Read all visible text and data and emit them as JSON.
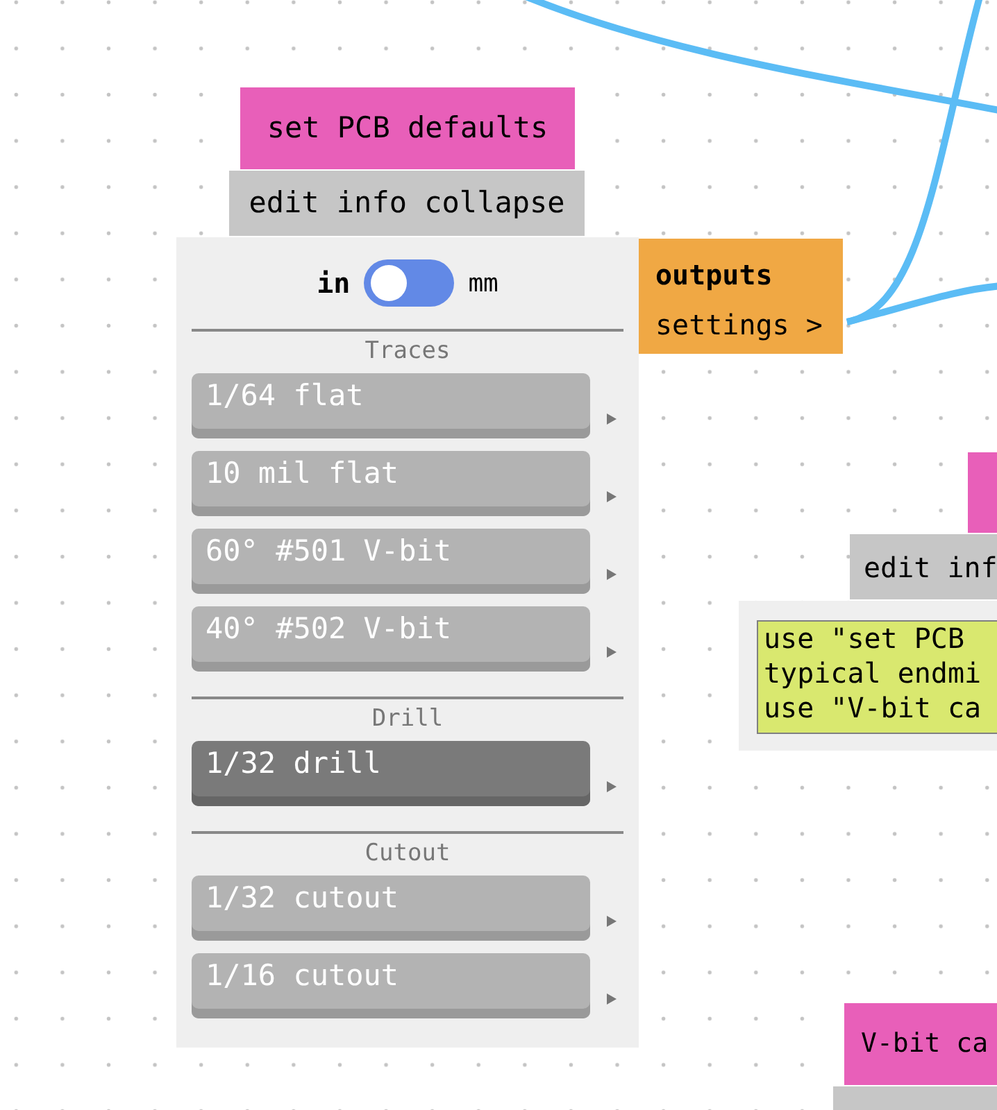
{
  "node_main": {
    "title": "set PCB defaults",
    "toolbar": "edit info collapse",
    "unit_toggle": {
      "left": "in",
      "right": "mm",
      "on": false
    },
    "sections": [
      {
        "heading": "Traces",
        "tools": [
          {
            "label": "1/64 flat",
            "selected": false
          },
          {
            "label": "10 mil flat",
            "selected": false
          },
          {
            "label": "60° #501 V-bit",
            "selected": false
          },
          {
            "label": "40° #502 V-bit",
            "selected": false
          }
        ]
      },
      {
        "heading": "Drill",
        "tools": [
          {
            "label": "1/32 drill",
            "selected": true
          }
        ]
      },
      {
        "heading": "Cutout",
        "tools": [
          {
            "label": "1/32 cutout",
            "selected": false
          },
          {
            "label": "1/16 cutout",
            "selected": false
          }
        ]
      }
    ],
    "outputs": {
      "title": "outputs",
      "link": "settings >"
    }
  },
  "node_note": {
    "toolbar": "edit inf",
    "note_lines": [
      "use \"set PCB",
      "typical endmi",
      "use \"V-bit ca"
    ]
  },
  "node_vbit": {
    "title": "V-bit ca"
  }
}
